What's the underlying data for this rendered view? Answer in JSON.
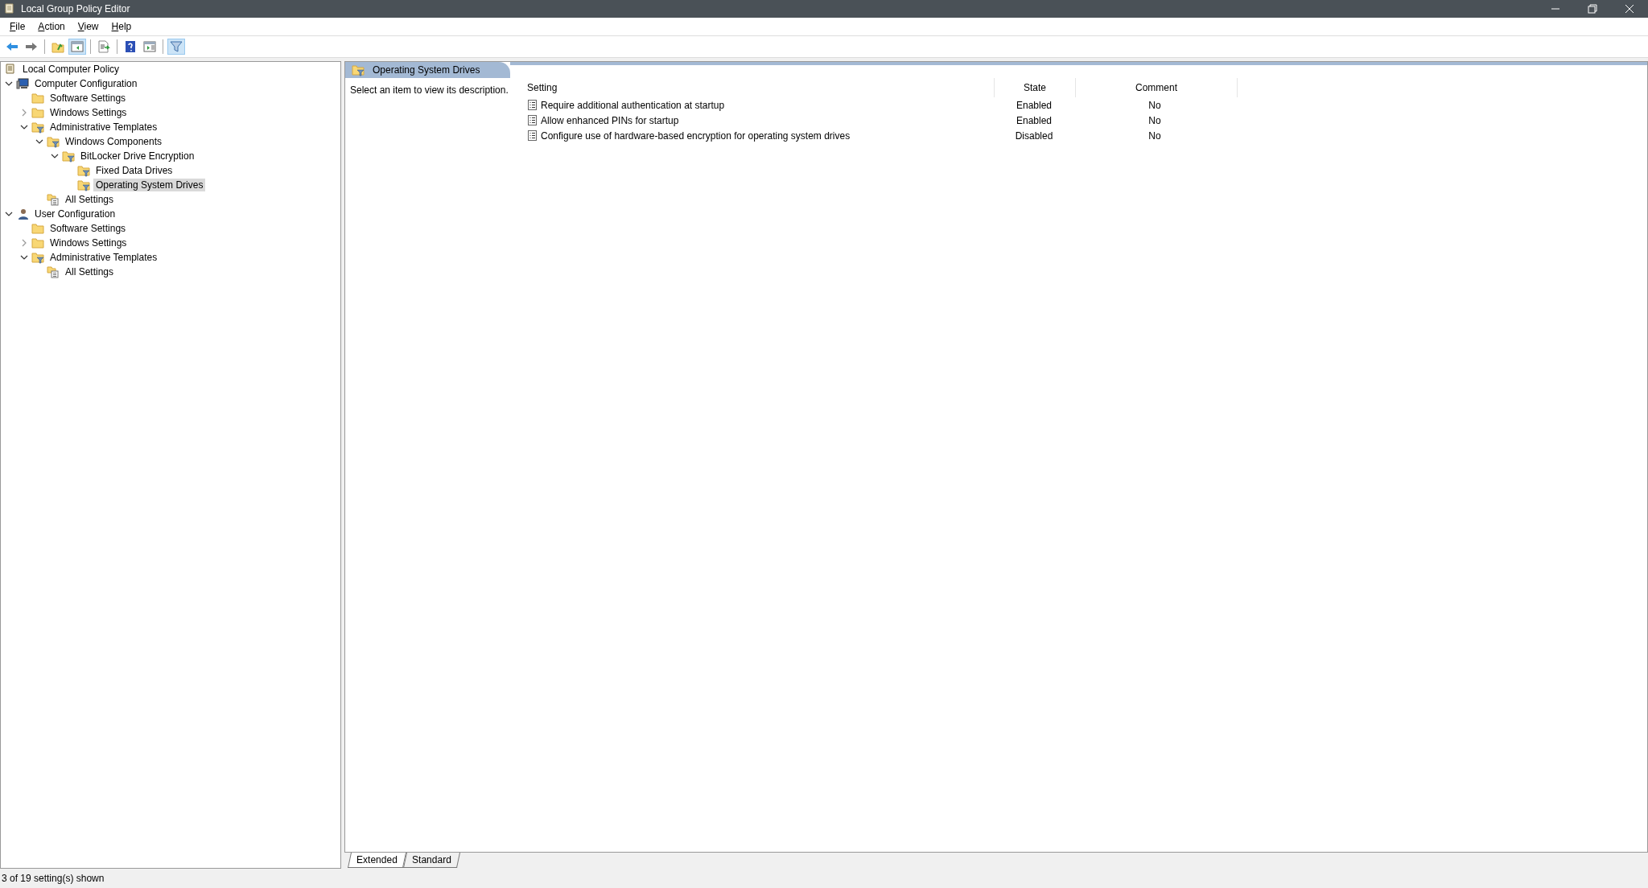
{
  "window": {
    "title": "Local Group Policy Editor"
  },
  "menu": [
    {
      "label": "File"
    },
    {
      "label": "Action"
    },
    {
      "label": "View"
    },
    {
      "label": "Help"
    }
  ],
  "toolbar": [
    {
      "kind": "back",
      "pressed": false
    },
    {
      "kind": "forward",
      "pressed": false
    },
    {
      "kind": "sep"
    },
    {
      "kind": "up",
      "pressed": false
    },
    {
      "kind": "tree",
      "pressed": true
    },
    {
      "kind": "sep"
    },
    {
      "kind": "export",
      "pressed": false
    },
    {
      "kind": "sep"
    },
    {
      "kind": "help",
      "pressed": false
    },
    {
      "kind": "pane",
      "pressed": false
    },
    {
      "kind": "sep"
    },
    {
      "kind": "filter",
      "pressed": true
    }
  ],
  "tree": [
    {
      "label": "Local Computer Policy",
      "kind": "policy",
      "selected": false,
      "children": [
        {
          "label": "Computer Configuration",
          "kind": "computer",
          "expanded": true,
          "selected": false,
          "children": [
            {
              "label": "Software Settings",
              "kind": "folder",
              "selected": false
            },
            {
              "label": "Windows Settings",
              "kind": "folder",
              "expanded": false,
              "selected": false
            },
            {
              "label": "Administrative Templates",
              "kind": "filter-folder",
              "expanded": true,
              "selected": false,
              "children": [
                {
                  "label": "Windows Components",
                  "kind": "filter-folder",
                  "expanded": true,
                  "selected": false,
                  "children": [
                    {
                      "label": "BitLocker Drive Encryption",
                      "kind": "filter-folder",
                      "expanded": true,
                      "selected": false,
                      "children": [
                        {
                          "label": "Fixed Data Drives",
                          "kind": "filter-folder",
                          "selected": false
                        },
                        {
                          "label": "Operating System Drives",
                          "kind": "filter-folder",
                          "selected": true
                        }
                      ]
                    }
                  ]
                },
                {
                  "label": "All Settings",
                  "kind": "all-settings",
                  "selected": false
                }
              ]
            }
          ]
        },
        {
          "label": "User Configuration",
          "kind": "user",
          "expanded": true,
          "selected": false,
          "children": [
            {
              "label": "Software Settings",
              "kind": "folder",
              "selected": false
            },
            {
              "label": "Windows Settings",
              "kind": "folder",
              "expanded": false,
              "selected": false
            },
            {
              "label": "Administrative Templates",
              "kind": "filter-folder",
              "expanded": true,
              "selected": false,
              "children": [
                {
                  "label": "All Settings",
                  "kind": "all-settings",
                  "selected": false
                }
              ]
            }
          ]
        }
      ]
    }
  ],
  "details": {
    "title": "Operating System Drives",
    "description": "Select an item to view its description.",
    "columns": [
      "Setting",
      "State",
      "Comment"
    ],
    "rows": [
      {
        "setting": "Require additional authentication at startup",
        "state": "Enabled",
        "comment": "No"
      },
      {
        "setting": "Allow enhanced PINs for startup",
        "state": "Enabled",
        "comment": "No"
      },
      {
        "setting": "Configure use of hardware-based encryption for operating system drives",
        "state": "Disabled",
        "comment": "No"
      }
    ],
    "tabs": [
      {
        "label": "Extended",
        "selected": true
      },
      {
        "label": "Standard",
        "selected": false
      }
    ]
  },
  "status_bar": "3 of 19 setting(s) shown"
}
